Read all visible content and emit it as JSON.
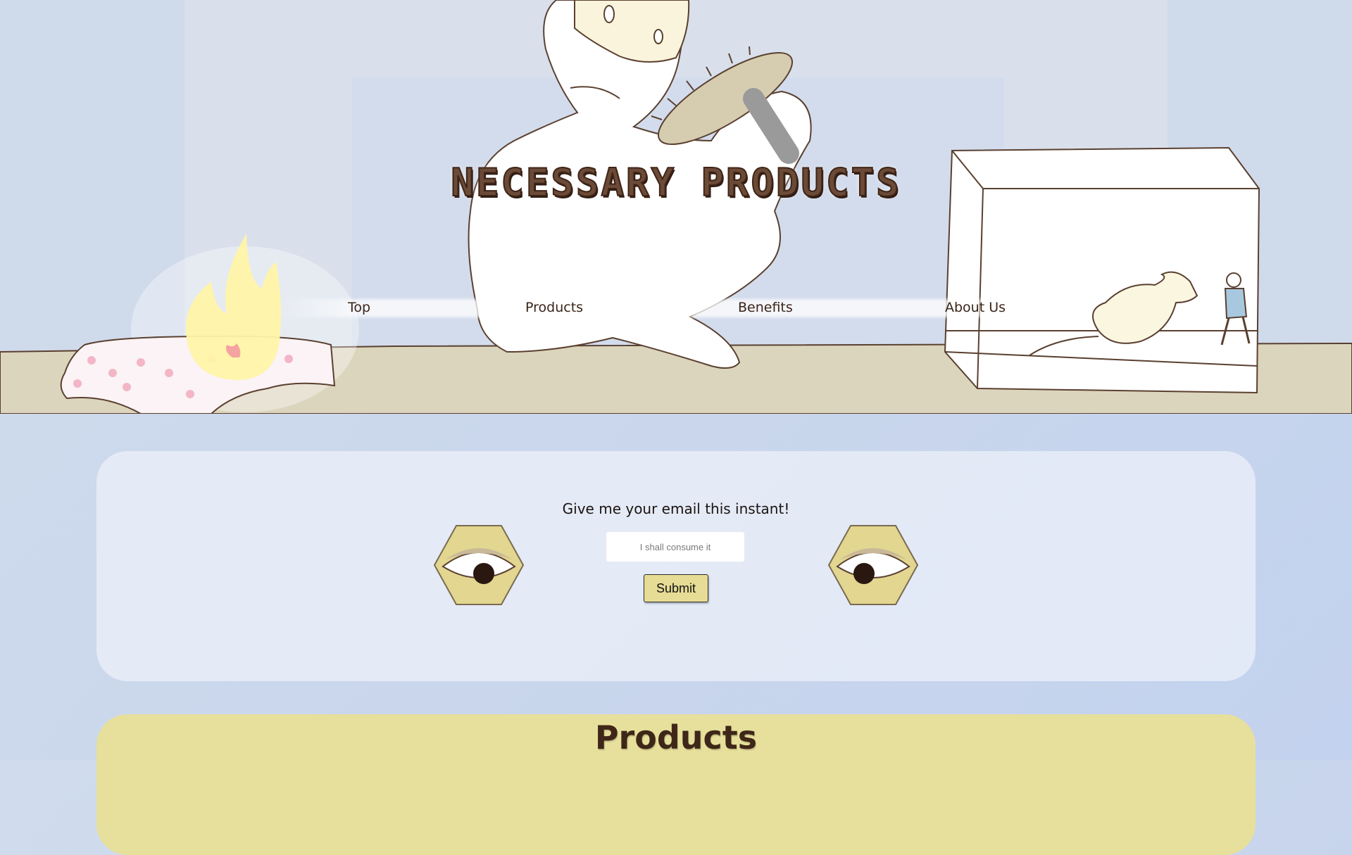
{
  "site": {
    "title": "NECESSARY PRODUCTS"
  },
  "nav": {
    "items": [
      {
        "label": "Top"
      },
      {
        "label": "Products"
      },
      {
        "label": "Benefits"
      },
      {
        "label": "About Us"
      }
    ]
  },
  "signup": {
    "title": "Give me your email this instant!",
    "email_placeholder": "I shall consume it",
    "submit_label": "Submit"
  },
  "products": {
    "heading": "Products"
  },
  "colors": {
    "background": "#c9d6ec",
    "panel": "#e7ecf6",
    "products_panel": "#e7e09c",
    "title_brown": "#4a2e1f",
    "submit_bg": "#e6dc95"
  },
  "icons": [
    "eye-hexagon-icon"
  ]
}
